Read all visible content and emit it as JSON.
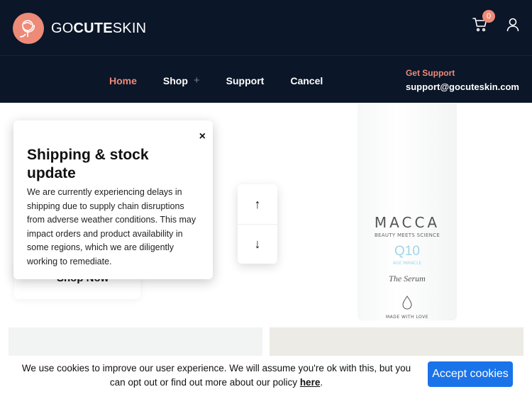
{
  "header": {
    "logo_text_go": "GO",
    "logo_text_cute": "CUTE",
    "logo_text_skin": "SKIN",
    "cart_count": "0"
  },
  "nav": {
    "items": [
      {
        "label": "Home",
        "active": true
      },
      {
        "label": "Shop",
        "has_submenu": true,
        "submenu_indicator": "+"
      },
      {
        "label": "Support"
      },
      {
        "label": "Cancel"
      }
    ]
  },
  "support": {
    "label": "Get Support",
    "email": "support@gocuteskin.com"
  },
  "product": {
    "brand": "MACCA",
    "tagline": "BEAUTY MEETS SCIENCE",
    "name": "Q10",
    "subname": "AGE MIRACLE",
    "type": "The Serum",
    "footer": "MADE WITH LOVE"
  },
  "shop_button": {
    "label": "Shop Now"
  },
  "scroll": {
    "up": "↑",
    "down": "↓"
  },
  "popup": {
    "close": "×",
    "title": "Shipping & stock update",
    "body": "We are currently experiencing delays in shipping due to supply chain disruptions from adverse weather conditions. This may impact orders and product availability in some regions, which we are diligently working to remediate."
  },
  "cookie": {
    "text": "We use cookies to improve our user experience. We will assume you're ok with this, but you can opt out or find out more about our policy",
    "link": "here",
    "period": ".",
    "accept": "Accept cookies"
  },
  "colors": {
    "header_bg": "#0b1628",
    "accent": "#ee8a78",
    "button_blue": "#1a73e8"
  }
}
